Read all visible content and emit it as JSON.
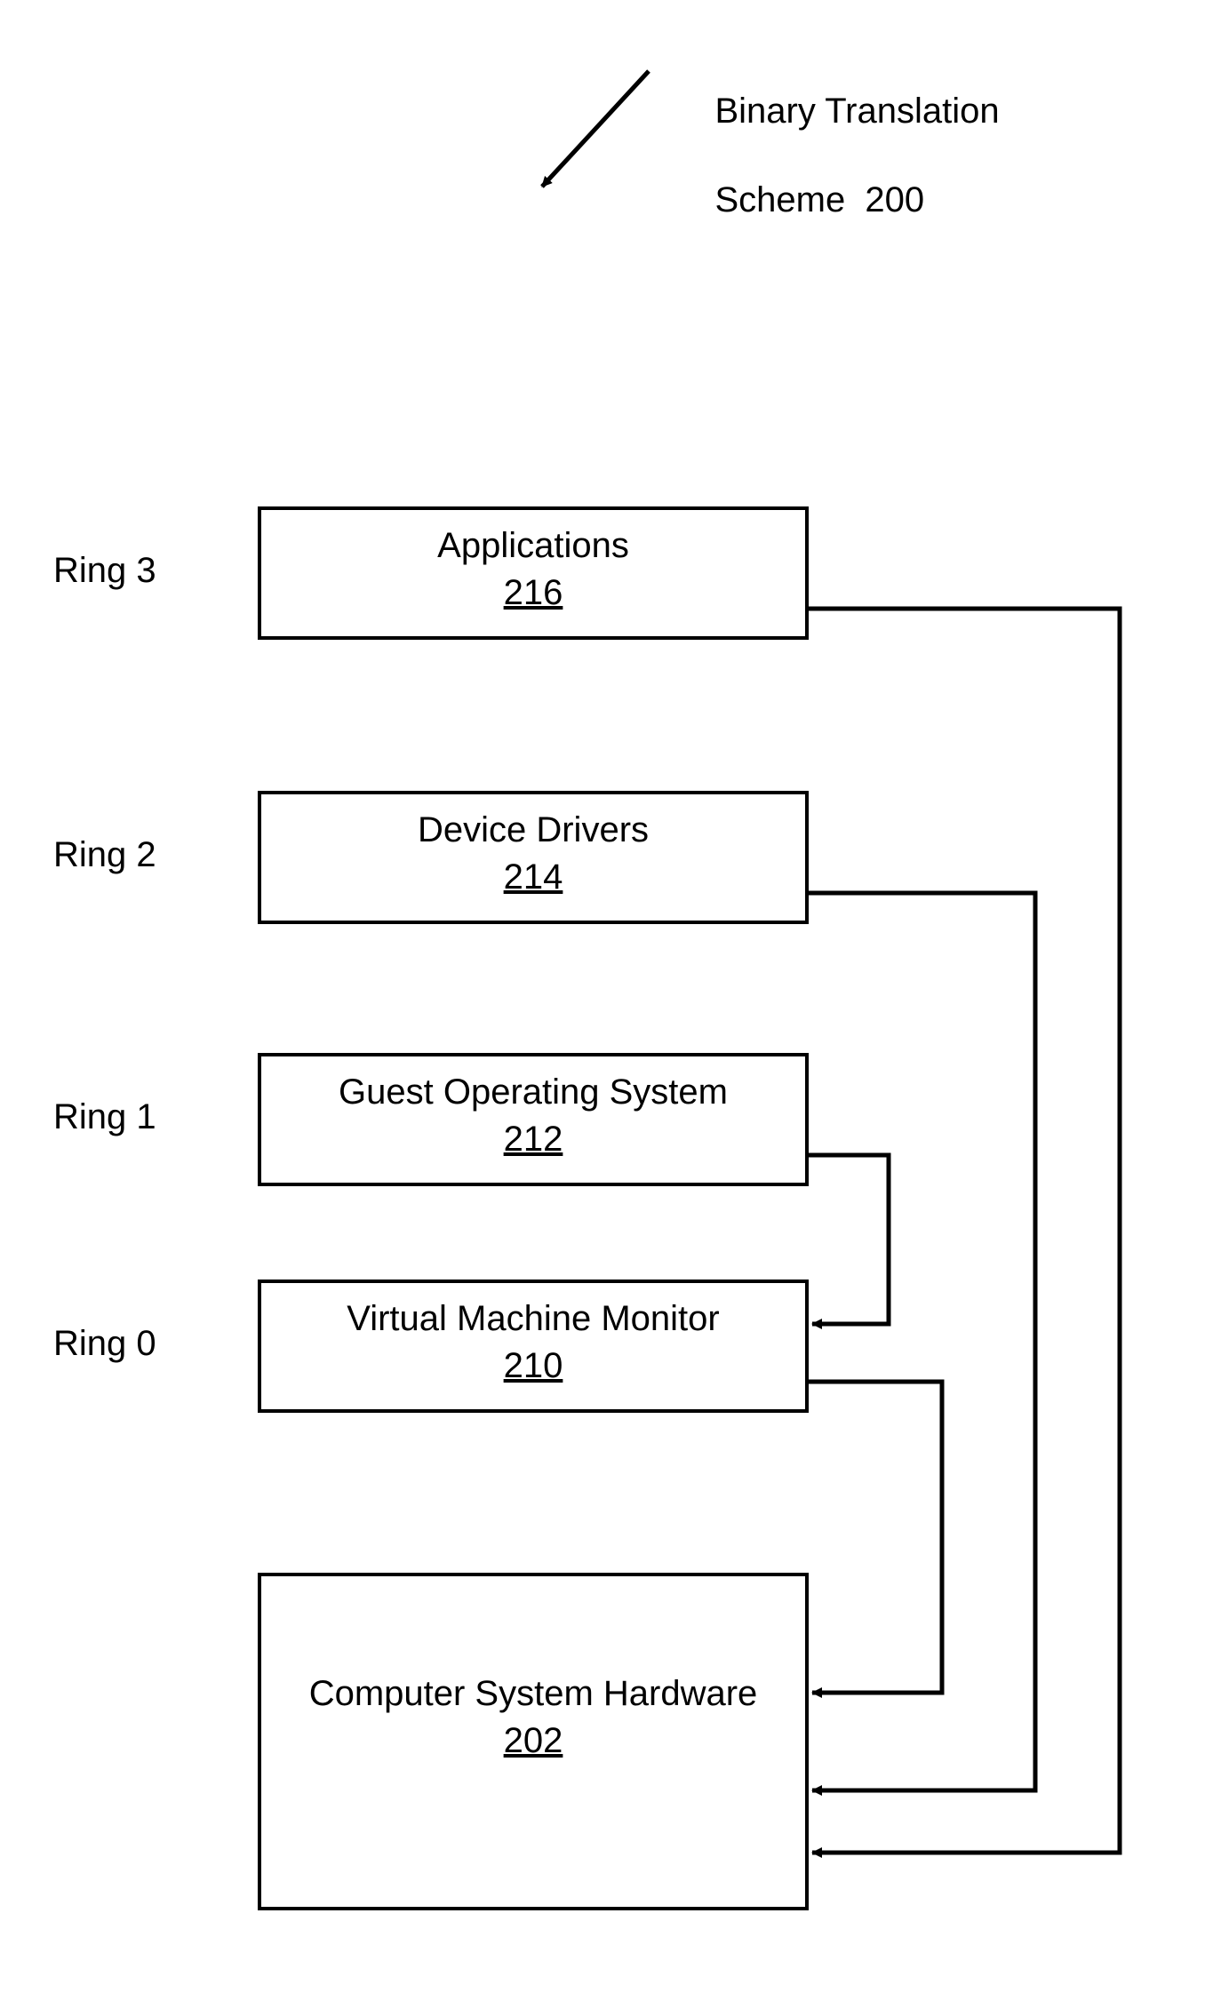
{
  "title": {
    "line1": "Binary Translation",
    "line2": "Scheme  200"
  },
  "rings": {
    "r3": "Ring 3",
    "r2": "Ring 2",
    "r1": "Ring 1",
    "r0": "Ring 0"
  },
  "boxes": {
    "apps": {
      "label": "Applications",
      "ref": "216"
    },
    "drivers": {
      "label": "Device Drivers",
      "ref": "214"
    },
    "guest": {
      "label": "Guest Operating System",
      "ref": "212"
    },
    "vmm": {
      "label": "Virtual Machine Monitor",
      "ref": "210"
    },
    "hw": {
      "label": "Computer System Hardware",
      "ref": "202"
    }
  }
}
